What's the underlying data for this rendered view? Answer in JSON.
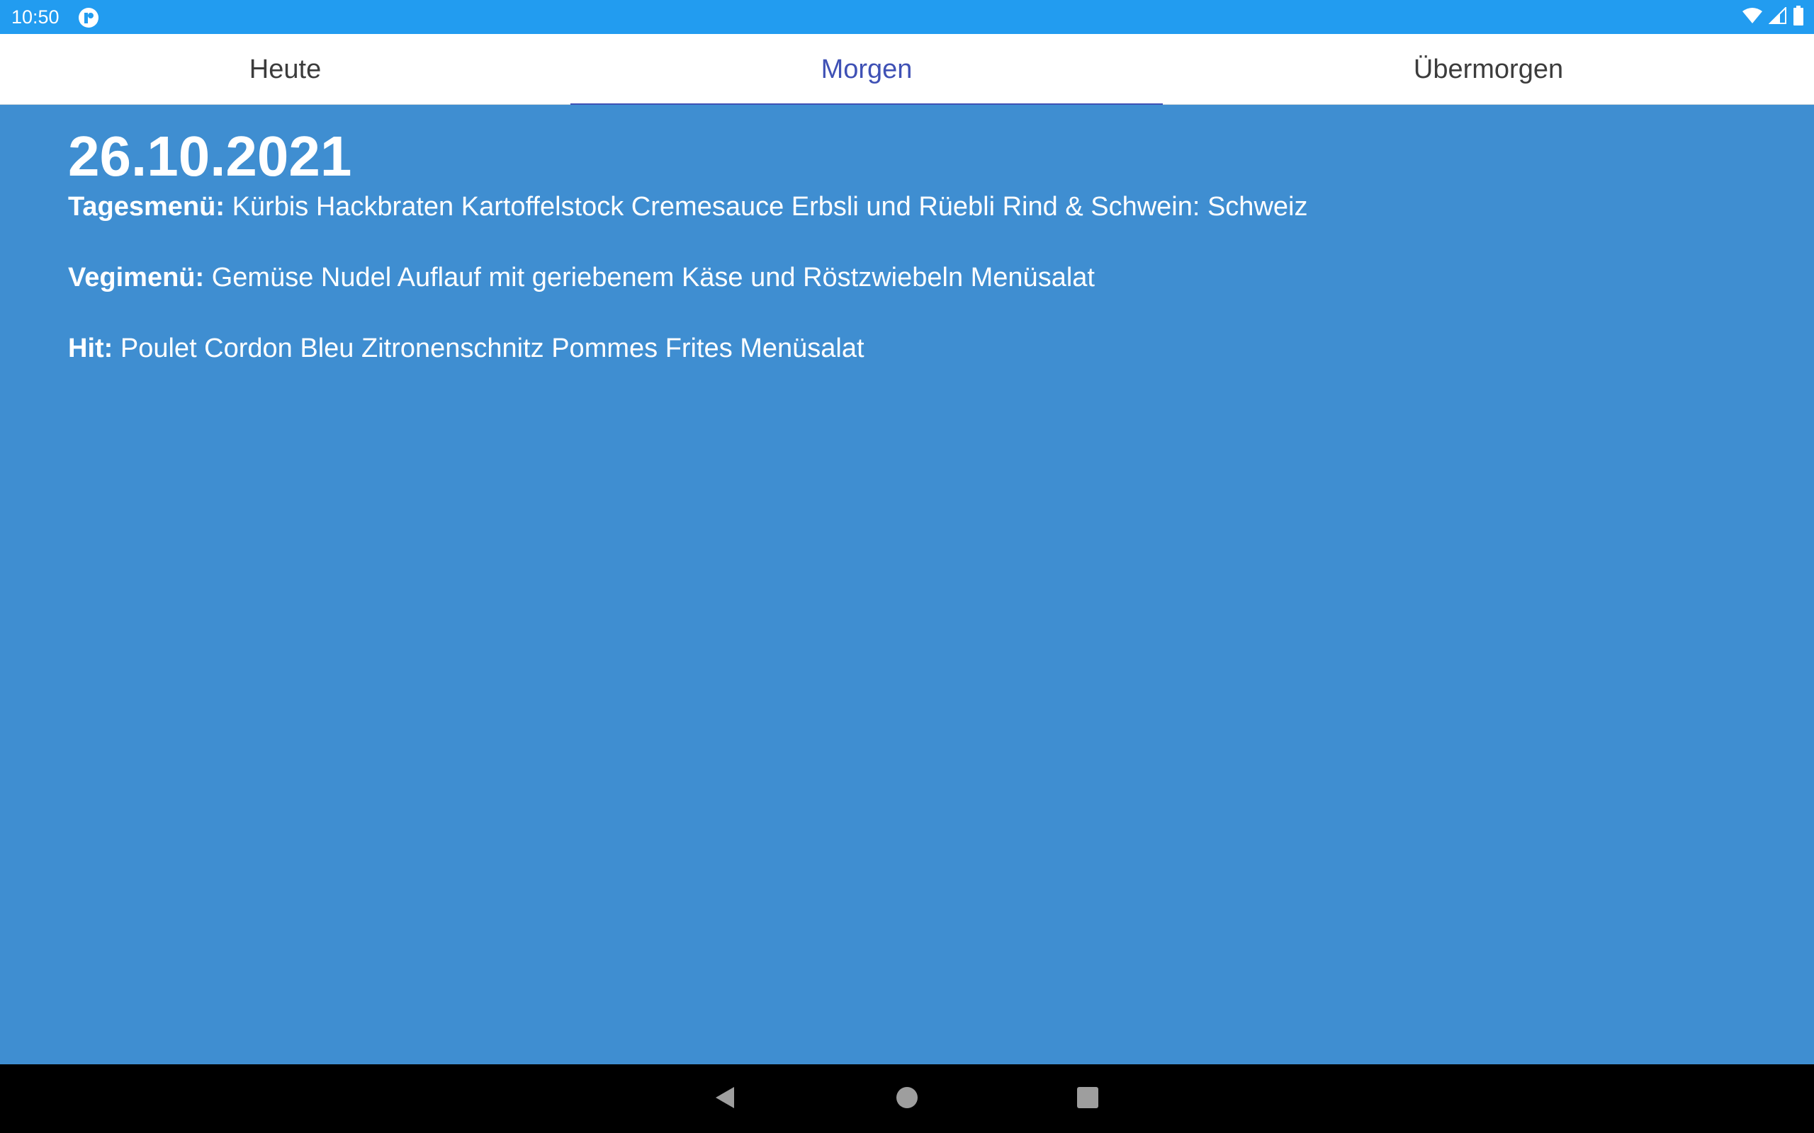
{
  "status_bar": {
    "time": "10:50",
    "icons": [
      "app-notification-icon",
      "wifi-icon",
      "signal-icon",
      "battery-icon"
    ]
  },
  "tabs": [
    {
      "label": "Heute",
      "active": false
    },
    {
      "label": "Morgen",
      "active": true
    },
    {
      "label": "Übermorgen",
      "active": false
    }
  ],
  "content": {
    "date": "26.10.2021",
    "menus": [
      {
        "label": "Tagesmenü:",
        "text": "Kürbis Hackbraten Kartoffelstock Cremesauce Erbsli und Rüebli Rind & Schwein: Schweiz"
      },
      {
        "label": "Vegimenü:",
        "text": "Gemüse Nudel Auflauf mit geriebenem Käse und Röstzwiebeln Menüsalat"
      },
      {
        "label": "Hit:",
        "text": "Poulet Cordon Bleu Zitronenschnitz Pommes Frites Menüsalat"
      }
    ]
  },
  "nav_bar": {
    "buttons": [
      "back-icon",
      "home-icon",
      "recents-icon"
    ]
  },
  "colors": {
    "status_bar": "#229cf0",
    "content_background": "#3f8ed1",
    "active_tab": "#3f51b5"
  }
}
